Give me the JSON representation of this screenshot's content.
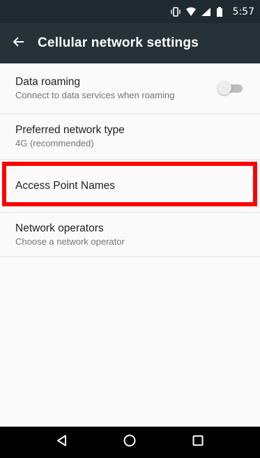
{
  "status_bar": {
    "time": "5:57",
    "icons": [
      "vibrate-icon",
      "wifi-icon",
      "signal-icon",
      "battery-icon"
    ]
  },
  "app_bar": {
    "title": "Cellular network settings",
    "back_icon": "arrow-left-icon"
  },
  "settings": {
    "items": [
      {
        "title": "Data roaming",
        "subtitle": "Connect to data services when roaming",
        "toggle": false
      },
      {
        "title": "Preferred network type",
        "subtitle": "4G (recommended)"
      },
      {
        "title": "Access Point Names",
        "subtitle": ""
      },
      {
        "title": "Network operators",
        "subtitle": "Choose a network operator"
      }
    ]
  },
  "nav_bar": {
    "icons": [
      "back-triangle-icon",
      "home-circle-icon",
      "recents-square-icon"
    ]
  },
  "colors": {
    "status_bar": "#1f2a30",
    "app_bar": "#263238",
    "background": "#fafafa",
    "highlight": "#ff0000"
  }
}
